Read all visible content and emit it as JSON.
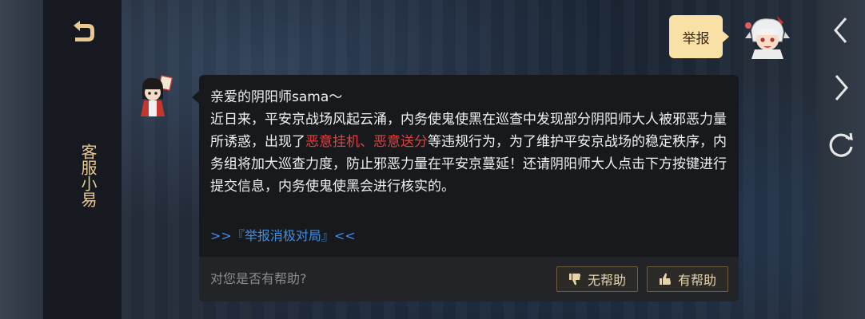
{
  "left_panel": {
    "back_icon": "back-arrow-icon",
    "title": "客服小易"
  },
  "right_rail": {
    "icons": [
      "chevron-left-icon",
      "chevron-right-icon",
      "refresh-icon"
    ]
  },
  "report": {
    "label": "举报"
  },
  "message": {
    "greeting": "亲爱的阴阳师sama～",
    "part1": "近日来，平安京战场风起云涌，内务使鬼使黑在巡查中发现部分阴阳师大人被邪恶力量所诱惑，出现了",
    "highlight": "恶意挂机、恶意送分",
    "part2": "等违规行为，为了维护平安京战场的稳定秩序，内务组将加大巡查力度，防止邪恶力量在平安京蔓延！还请阴阳师大人点击下方按键进行提交信息，内务使鬼使黑会进行核实的。",
    "link": ">>『举报消极对局』<<"
  },
  "feedback": {
    "question": "对您是否有帮助?",
    "not_helpful": "无帮助",
    "helpful": "有帮助"
  },
  "colors": {
    "accent_gold": "#e8c98f",
    "bubble": "#f9e1a6",
    "highlight_red": "#e0413f",
    "link_blue": "#3d8fe6"
  }
}
